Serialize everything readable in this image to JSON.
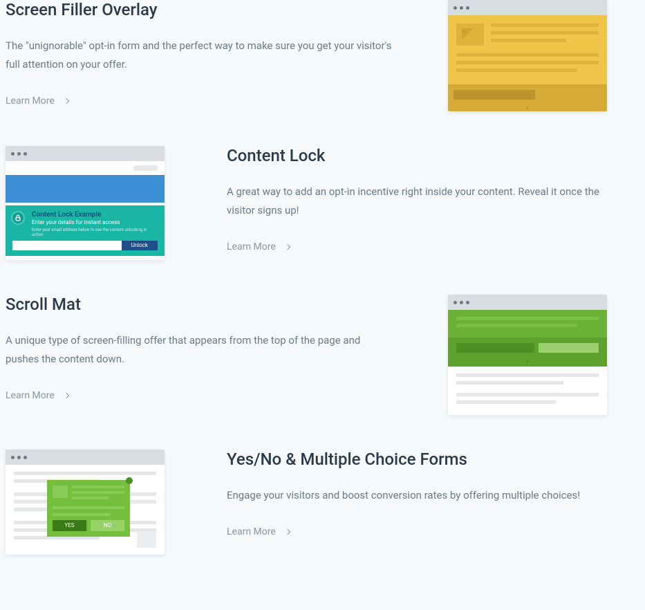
{
  "learn_more": "Learn More",
  "sections": [
    {
      "title": "Screen Filler Overlay",
      "desc": "The \"unignorable\" opt-in form and the perfect way to make sure you get your visitor's full attention on your offer."
    },
    {
      "title": "Content Lock",
      "desc": "A great way to add an opt-in incentive right inside your content. Reveal it once the visitor signs up!",
      "mock": {
        "lock_title": "Content Lock Example",
        "lock_sub": "Enter your details for instant access",
        "lock_desc": "Enter your email address below to see the content unlocking in action",
        "unlock_btn": "Unlock"
      }
    },
    {
      "title": "Scroll Mat",
      "desc": "A unique type of screen-filling offer that appears from the top of the page and pushes the content down."
    },
    {
      "title": "Yes/No & Multiple Choice Forms",
      "desc": "Engage your visitors and boost conversion rates by offering multiple choices!",
      "mock": {
        "yes": "YES",
        "no": "NO"
      }
    }
  ]
}
